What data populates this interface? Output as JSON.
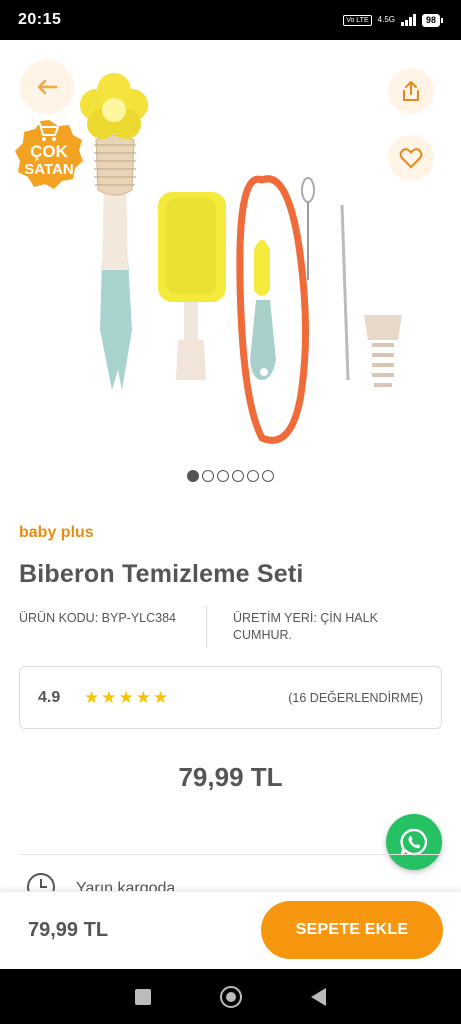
{
  "status_bar": {
    "time": "20:15",
    "lte": "Vo LTE",
    "network": "4.5G",
    "battery": "98"
  },
  "gallery": {
    "badge_line1": "ÇOK",
    "badge_line2": "SATAN",
    "page_count": 6,
    "active_page": 1
  },
  "product": {
    "brand": "baby plus",
    "title": "Biberon Temizleme Seti",
    "code_label": "ÜRÜN KODU: BYP-YLC384",
    "origin_label": "ÜRETİM YERİ: ÇİN HALK CUMHUR.",
    "rating": "4.9",
    "stars": 5,
    "review_count": "(16 DEĞERLENDİRME)",
    "price": "79,99 TL"
  },
  "delivery": {
    "label": "Yarın kargoda"
  },
  "bottom_bar": {
    "price": "79,99 TL",
    "add_to_cart": "SEPETE EKLE"
  },
  "colors": {
    "accent": "#f7960f",
    "brand": "#e88c12",
    "whatsapp": "#26c163"
  }
}
